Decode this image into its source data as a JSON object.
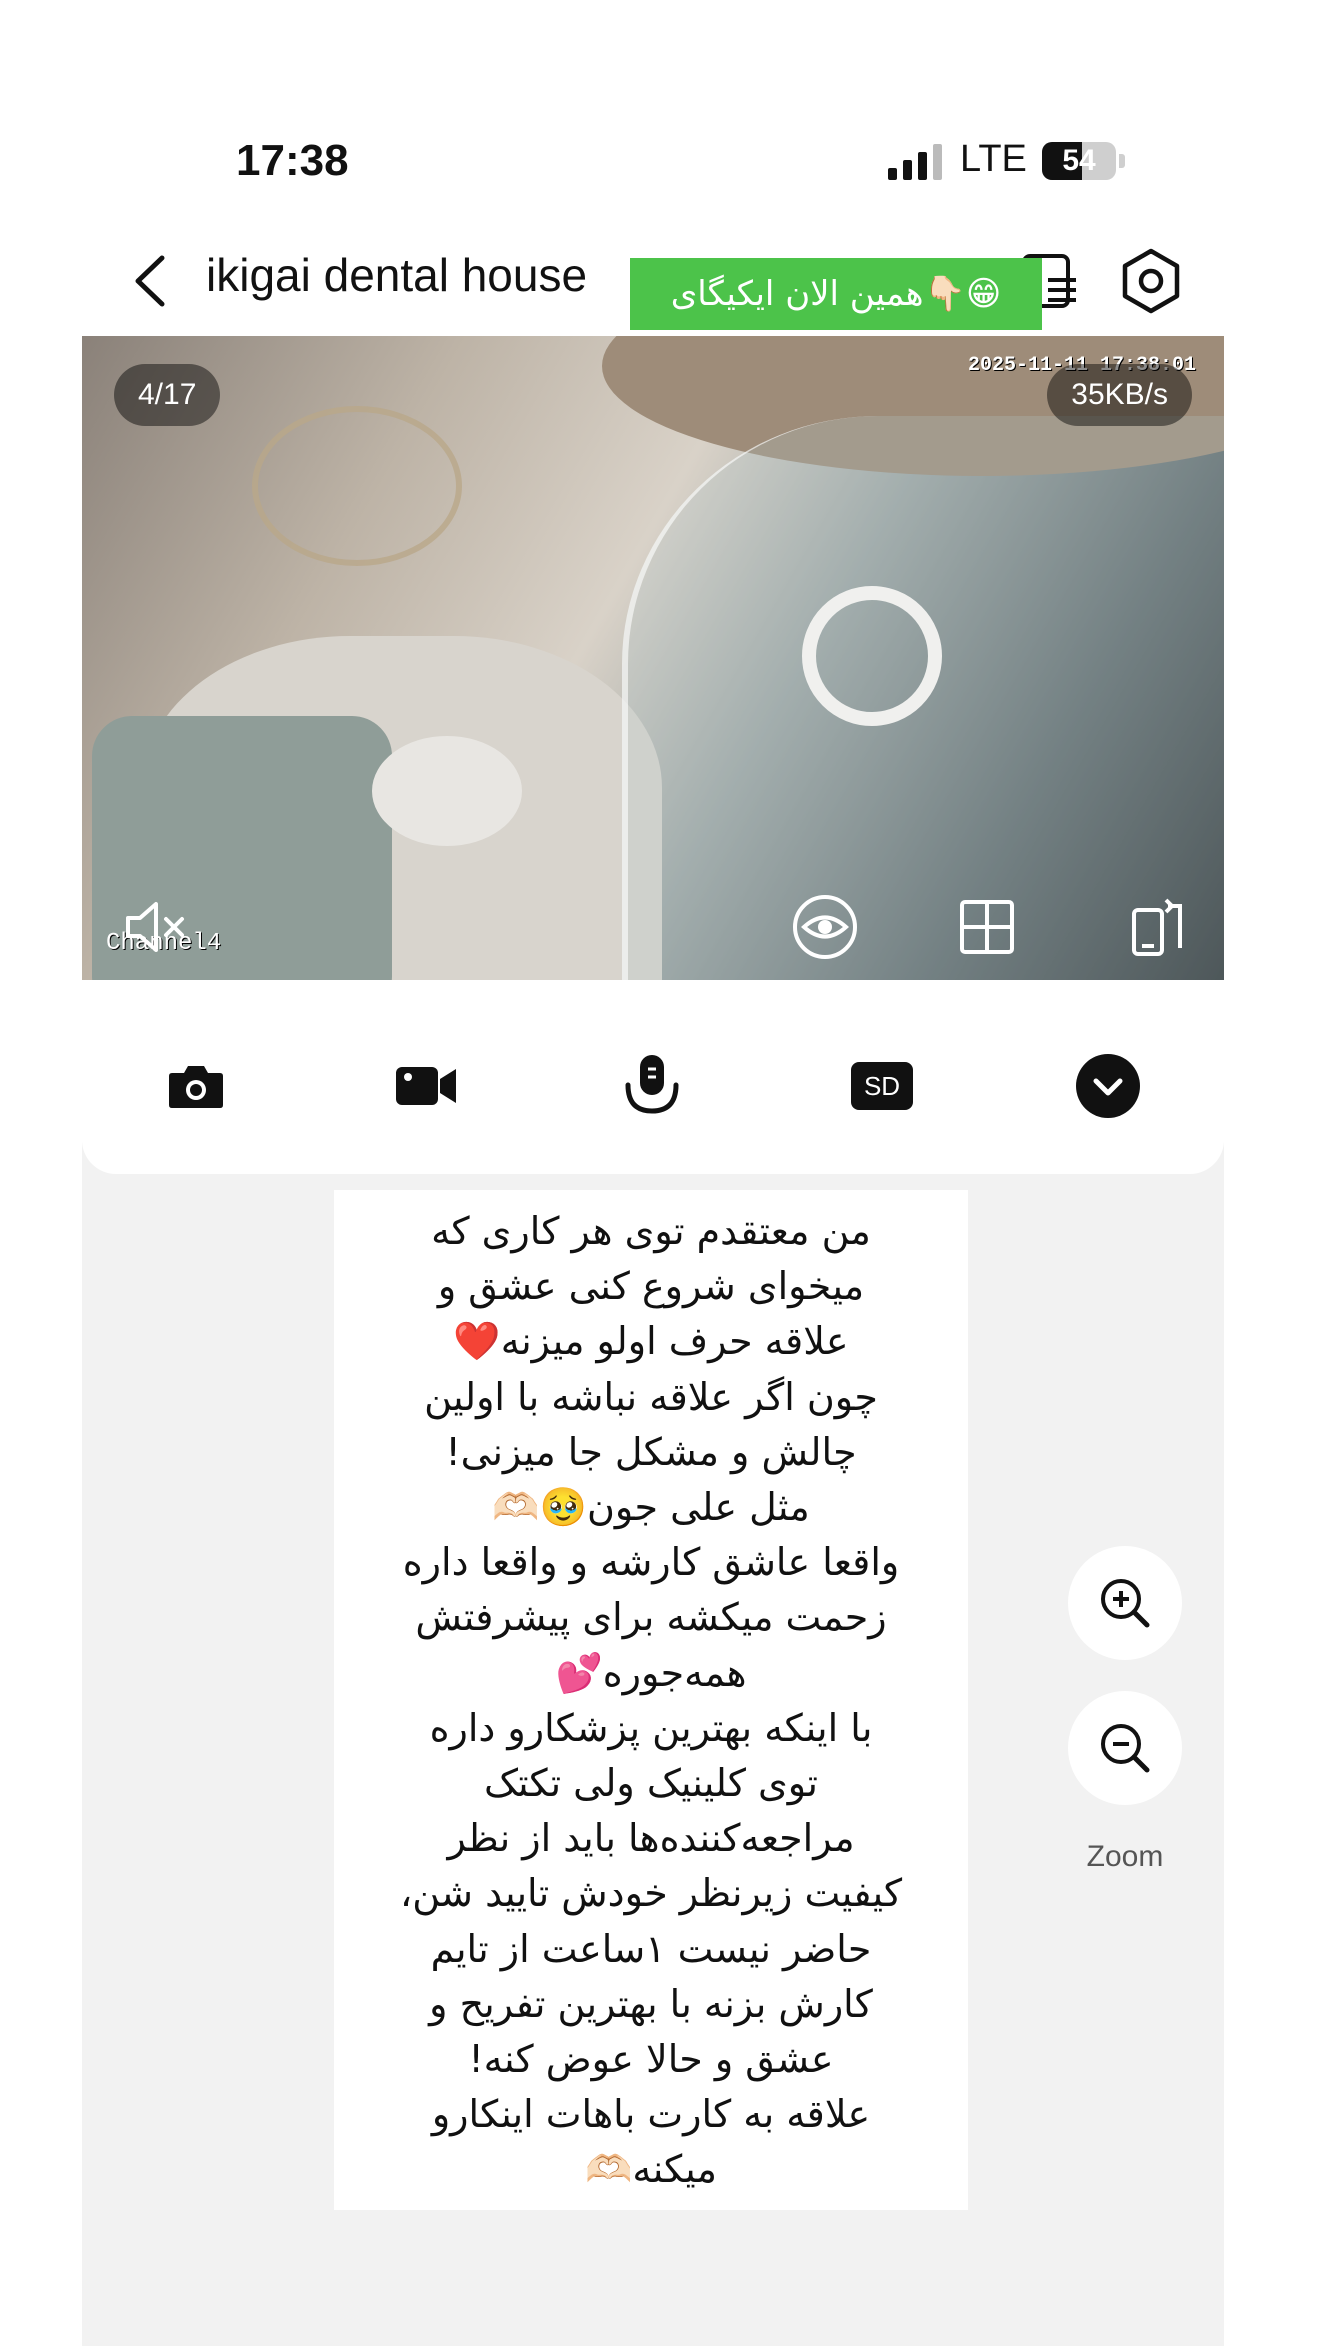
{
  "status_bar": {
    "time": "17:38",
    "network": "LTE",
    "battery": "54",
    "battery_level": 0.54
  },
  "nav": {
    "title": "ikigai dental house",
    "banner": "همین الان ایکیگای👇🏻😁"
  },
  "video": {
    "channel_counter": "4/17",
    "speed": "35KB/s",
    "timestamp": "2025-11-11 17:38:01",
    "channel_label": "Channel4",
    "controls": [
      "mute-icon",
      "eye-icon",
      "grid-icon",
      "rotate-screen-icon"
    ]
  },
  "toolbar": {
    "items": [
      "camera-icon",
      "video-record-icon",
      "microphone-icon",
      "sd-icon",
      "more-chevron-icon"
    ],
    "sd_label": "SD"
  },
  "message": {
    "lines": [
      "من معتقدم توی هر کاری که",
      "میخوای شروع کنی عشق و",
      "علاقه حرف اولو میزنه❤️",
      "چون اگر علاقه نباشه با اولین",
      "چالش و مشکل جا میزنی!",
      "مثل علی جون🥹🫶🏻",
      "واقعا عاشق کارشه و واقعا داره",
      "زحمت میکشه برای پیشرفتش",
      "همه‌جوره💕",
      "با اینکه بهترین پزشکارو داره",
      "توی کلینیک ولی تکتک",
      "مراجعه‌کننده‌ها باید از نظر",
      "کیفیت زیرنظر خودش تایید شن،",
      "حاضر نیست ۱ساعت از تایم",
      "کارش بزنه با بهترین تفریح و",
      "عشق و حالا عوض کنه!",
      "علاقه به کارت باهات اینکارو",
      "میکنه🫶🏻"
    ]
  },
  "zoom": {
    "label": "Zoom",
    "zoom_in_icon": "zoom-in-icon",
    "zoom_out_icon": "zoom-out-icon"
  },
  "colors": {
    "banner_green": "#4cc34a",
    "icon_dark": "#111111",
    "page_gray": "#f2f2f2"
  }
}
